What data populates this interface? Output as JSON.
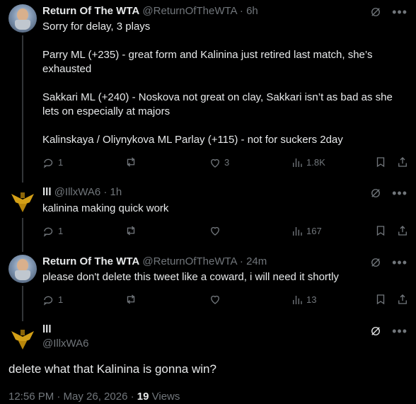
{
  "tweet1": {
    "name": "Return Of The WTA",
    "handle": "@ReturnOfTheWTA",
    "sep": "·",
    "time": "6h",
    "lines": [
      "Sorry for delay, 3 plays",
      "",
      "Parry ML (+235) - great form and Kalinina just retired last match, she’s",
      "exhausted",
      "",
      "Sakkari ML (+240) - Noskova not great on clay, Sakkari isn’t as bad as she",
      "lets on especially at majors",
      "",
      "Kalinskaya / Oliynykova ML Parlay (+115) - not for suckers 2day"
    ],
    "replies": "1",
    "likes": "3",
    "views": "1.8K"
  },
  "tweet2": {
    "name": "lll",
    "handle": "@IllxWA6",
    "sep": "·",
    "time": "1h",
    "text": "kalinina making quick work",
    "replies": "1",
    "views": "167"
  },
  "tweet3": {
    "name": "Return Of The WTA",
    "handle": "@ReturnOfTheWTA",
    "sep": "·",
    "time": "24m",
    "text": "please don't delete this tweet like a coward, i will need it shortly",
    "replies": "1",
    "views": "13"
  },
  "main": {
    "name": "lll",
    "handle": "@IllxWA6",
    "text": "delete what that Kalinina is gonna win?",
    "timestamp": "12:56 PM · May 26, 2026 ·",
    "views_count": "19",
    "views_label": "Views"
  },
  "icons": {
    "reply": "reply-icon",
    "repost": "repost-icon",
    "like": "like-icon",
    "views": "views-icon",
    "bookmark": "bookmark-icon",
    "share": "share-icon",
    "grok": "grok-icon",
    "more": "more-icon"
  },
  "colors": {
    "background": "#000000",
    "text": "#e7e9ea",
    "secondary": "#71767b",
    "thread_line": "#333639"
  }
}
